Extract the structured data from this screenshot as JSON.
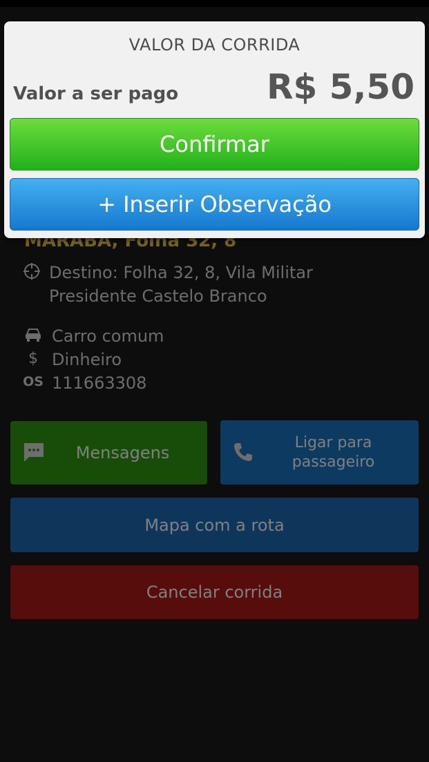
{
  "dialog": {
    "title": "VALOR DA CORRIDA",
    "amount_label": "Valor a ser pago",
    "amount_value": "R$ 5,50",
    "confirm_label": "Confirmar",
    "observation_label": "+ Inserir Observação"
  },
  "ride": {
    "origin": "MARABA, Folha 32, 8",
    "destination": "Destino: Folha 32, 8, Vila Militar Presidente Castelo Branco",
    "vehicle": "Carro comum",
    "payment": "Dinheiro",
    "os_label": "OS",
    "os_number": "111663308"
  },
  "actions": {
    "messages_label": "Mensagens",
    "call_label": "Ligar para passageiro",
    "map_label": "Mapa com a rota",
    "cancel_label": "Cancelar corrida"
  },
  "colors": {
    "confirm": "#22b11b",
    "observation": "#1578d0",
    "messages": "#2e9a12",
    "call": "#1a74c0",
    "map": "#1a6cb4",
    "cancel": "#b01a1a",
    "origin_text": "#e8c33a"
  },
  "icons": {
    "destination": "crosshair-icon",
    "vehicle": "car-icon",
    "payment": "dollar-icon",
    "messages": "chat-bubble-icon",
    "call": "phone-icon"
  }
}
